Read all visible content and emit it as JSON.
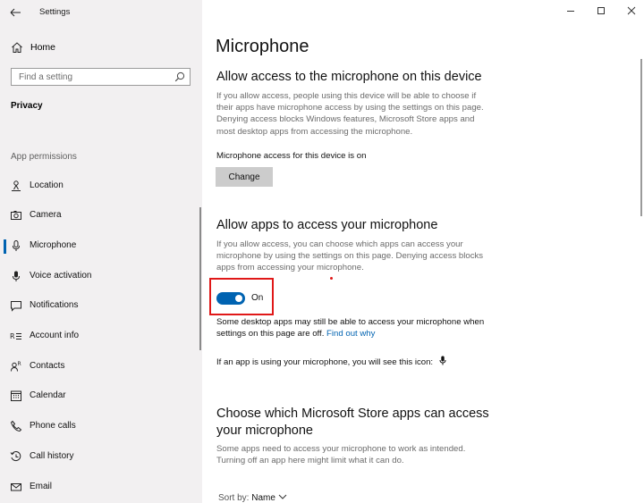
{
  "app": {
    "title": "Settings"
  },
  "sidebar": {
    "home_label": "Home",
    "search_placeholder": "Find a setting",
    "section_label": "Privacy",
    "group_label": "App permissions",
    "items": [
      {
        "label": "Location",
        "icon": "location-icon"
      },
      {
        "label": "Camera",
        "icon": "camera-icon"
      },
      {
        "label": "Microphone",
        "icon": "microphone-icon",
        "active": true
      },
      {
        "label": "Voice activation",
        "icon": "voice-activation-icon"
      },
      {
        "label": "Notifications",
        "icon": "notifications-icon"
      },
      {
        "label": "Account info",
        "icon": "account-info-icon"
      },
      {
        "label": "Contacts",
        "icon": "contacts-icon"
      },
      {
        "label": "Calendar",
        "icon": "calendar-icon"
      },
      {
        "label": "Phone calls",
        "icon": "phone-icon"
      },
      {
        "label": "Call history",
        "icon": "call-history-icon"
      },
      {
        "label": "Email",
        "icon": "email-icon"
      }
    ]
  },
  "main": {
    "title": "Microphone",
    "device_section": {
      "heading": "Allow access to the microphone on this device",
      "description": "If you allow access, people using this device will be able to choose if their apps have microphone access by using the settings on this page. Denying access blocks Windows features, Microsoft Store apps and most desktop apps from accessing the microphone.",
      "status": "Microphone access for this device is on",
      "change_label": "Change"
    },
    "apps_section": {
      "heading": "Allow apps to access your microphone",
      "description": "If you allow access, you can choose which apps can access your microphone by using the settings on this page. Denying access blocks apps from accessing your microphone.",
      "toggle_label": "On",
      "toggle_on": true,
      "desktop_note": "Some desktop apps may still be able to access your microphone when settings on this page are off.",
      "find_out_link": "Find out why",
      "icon_note": "If an app is using your microphone, you will see this icon:"
    },
    "store_section": {
      "heading": "Choose which Microsoft Store apps can access your microphone",
      "description": "Some apps need to access your microphone to work as intended. Turning off an app here might limit what it can do.",
      "sort_prefix": "Sort by:",
      "sort_value": "Name"
    }
  },
  "colors": {
    "accent": "#0063b1",
    "highlight": "#e01818",
    "sidebar_bg": "#f2f0f1"
  }
}
